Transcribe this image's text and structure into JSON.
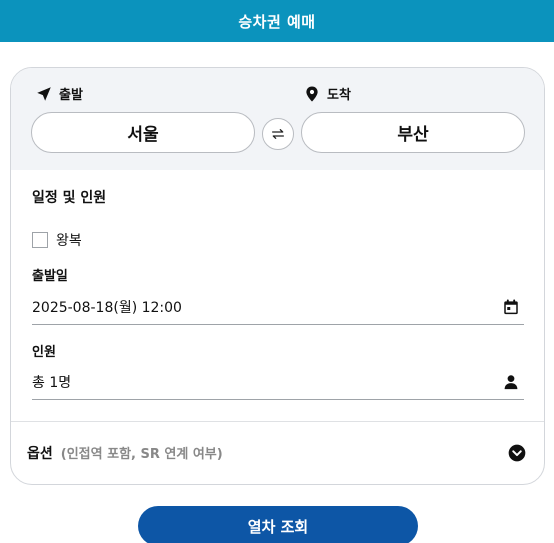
{
  "header": {
    "title": "승차권 예매"
  },
  "route": {
    "from_label": "출발",
    "to_label": "도착",
    "from_station": "서울",
    "to_station": "부산"
  },
  "schedule": {
    "section_title": "일정 및 인원",
    "roundtrip_label": "왕복",
    "roundtrip_checked": false,
    "date_label": "출발일",
    "date_value": "2025-08-18(월) 12:00",
    "people_label": "인원",
    "people_value": "총 1명"
  },
  "options": {
    "title": "옵션",
    "description": "(인접역 포함, SR 연계 여부)"
  },
  "actions": {
    "search_label": "열차 조회"
  },
  "colors": {
    "header_bg": "#0b93bd",
    "button_bg": "#0d56a6",
    "route_bg": "#f2f4f7"
  },
  "icons": {
    "from": "navigation-arrow-icon",
    "to": "map-pin-icon",
    "swap": "swap-arrows-icon",
    "date": "calendar-icon",
    "people": "person-icon",
    "options": "chevron-down-circle-icon"
  }
}
